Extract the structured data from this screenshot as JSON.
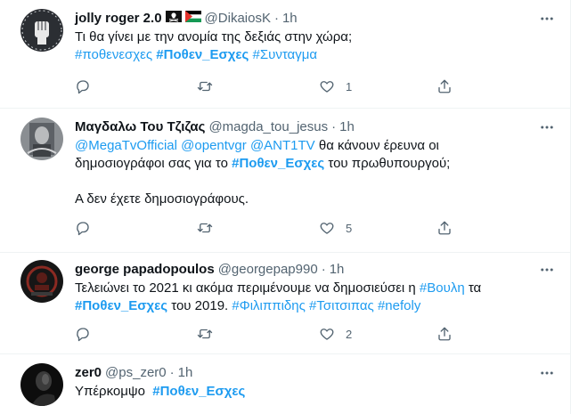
{
  "tweets": [
    {
      "name": "jolly roger 2.0",
      "handle": "@DikaiosK",
      "time": "1h",
      "lines": [
        [
          {
            "t": "Τι θα γίνει με την ανομία της δεξιάς στην χώρα;",
            "c": "plain"
          }
        ],
        [
          {
            "t": "#ποθενεσχες",
            "c": "link"
          },
          {
            "t": " ",
            "c": "plain"
          },
          {
            "t": "#Ποθεν_Εσχες",
            "c": "link bold"
          },
          {
            "t": " ",
            "c": "plain"
          },
          {
            "t": "#Συνταγμα",
            "c": "link"
          }
        ]
      ],
      "like_count": "1",
      "retweet_count": ""
    },
    {
      "name": "Μαγδαλω Του Τζιζας",
      "handle": "@magda_tou_jesus",
      "time": "1h",
      "lines": [
        [
          {
            "t": "@MegaTvOfficial",
            "c": "link"
          },
          {
            "t": " ",
            "c": "plain"
          },
          {
            "t": "@opentvgr",
            "c": "link"
          },
          {
            "t": " ",
            "c": "plain"
          },
          {
            "t": "@ANT1TV",
            "c": "link"
          },
          {
            "t": " θα κάνουν έρευνα οι",
            "c": "plain"
          }
        ],
        [
          {
            "t": "δημοσιογράφοι σας για το ",
            "c": "plain"
          },
          {
            "t": "#Ποθεν_Εσχες",
            "c": "link bold"
          },
          {
            "t": " του πρωθυπουργού;",
            "c": "plain"
          }
        ],
        [
          {
            "t": "",
            "c": "plain"
          }
        ],
        [
          {
            "t": "Α δεν έχετε δημοσιογράφους.",
            "c": "plain"
          }
        ]
      ],
      "like_count": "5",
      "retweet_count": ""
    },
    {
      "name": "george papadopoulos",
      "handle": "@georgepap990",
      "time": "1h",
      "lines": [
        [
          {
            "t": "Τελειώνει το 2021 κι ακόμα περιμένουμε να δημοσιεύσει η ",
            "c": "plain"
          },
          {
            "t": "#Βουλη",
            "c": "link"
          },
          {
            "t": " τα",
            "c": "plain"
          }
        ],
        [
          {
            "t": "#Ποθεν_Εσχες",
            "c": "link bold"
          },
          {
            "t": " του 2019. ",
            "c": "plain"
          },
          {
            "t": "#Φιλιππιδης",
            "c": "link"
          },
          {
            "t": " ",
            "c": "plain"
          },
          {
            "t": "#Τσιτσιπας",
            "c": "link"
          },
          {
            "t": " ",
            "c": "plain"
          },
          {
            "t": "#nefoly",
            "c": "link"
          }
        ]
      ],
      "like_count": "2",
      "retweet_count": ""
    },
    {
      "name": "zer0",
      "handle": "@ps_zer0",
      "time": "1h",
      "lines": [
        [
          {
            "t": "Υπέρκομψο  ",
            "c": "plain"
          },
          {
            "t": "#Ποθεν_Εσχες",
            "c": "link bold"
          }
        ]
      ],
      "like_count": "",
      "retweet_count": ""
    }
  ],
  "colors": {
    "link": "#1d9bf0",
    "secondary": "#536471",
    "text": "#0f1419",
    "border": "#eff3f4"
  },
  "icons": [
    "reply-icon",
    "retweet-icon",
    "like-icon",
    "share-icon",
    "more-icon",
    "pirate-flag-icon",
    "palestine-flag-icon"
  ]
}
